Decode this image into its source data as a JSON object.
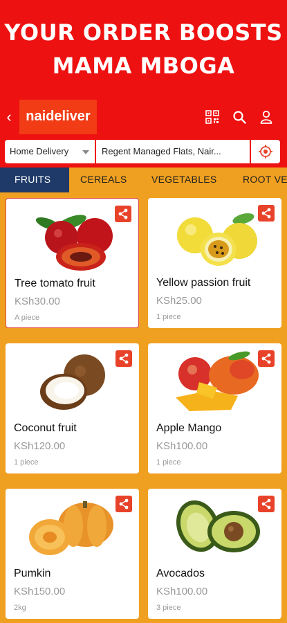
{
  "banner": {
    "line1": "YOUR ORDER BOOSTS",
    "line2": "MAMA MBOGA"
  },
  "appbar": {
    "back": "‹",
    "logo": "naideliver"
  },
  "location": {
    "delivery_mode": "Home Delivery",
    "address": "Regent Managed Flats, Nair..."
  },
  "tabs": [
    "FRUITS",
    "CEREALS",
    "VEGETABLES",
    "ROOT VE"
  ],
  "products": [
    {
      "name": "Tree tomato fruit",
      "price": "KSh30.00",
      "unit": "A piece",
      "icon": "tree-tomato-image"
    },
    {
      "name": "Yellow passion fruit",
      "price": "KSh25.00",
      "unit": "1 piece",
      "icon": "passion-fruit-image"
    },
    {
      "name": "Coconut fruit",
      "price": "KSh120.00",
      "unit": "1 piece",
      "icon": "coconut-image"
    },
    {
      "name": "Apple Mango",
      "price": "KSh100.00",
      "unit": "1 piece",
      "icon": "mango-image"
    },
    {
      "name": "Pumkin",
      "price": "KSh150.00",
      "unit": "2kg",
      "icon": "pumpkin-image"
    },
    {
      "name": "Avocados",
      "price": "KSh100.00",
      "unit": "3 piece",
      "icon": "avocado-image"
    }
  ],
  "colors": {
    "brand_red": "#ee1111",
    "accent_orange": "#f0a020",
    "active_tab": "#1f3a68",
    "share": "#e8432a"
  }
}
